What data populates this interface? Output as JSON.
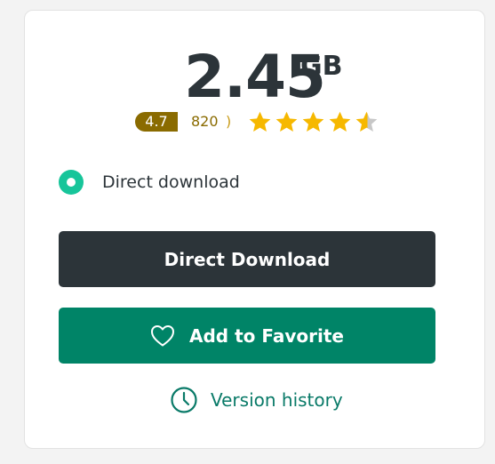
{
  "file": {
    "size_value": "2.45",
    "size_unit": "GB"
  },
  "rating": {
    "score": "4.7",
    "count": "820",
    "count_suffix": ")",
    "stars_value": 4.7,
    "stars_max": 5
  },
  "options": {
    "direct_download_label": "Direct download",
    "selected": true
  },
  "buttons": {
    "direct_download": "Direct Download",
    "add_favorite": "Add to Favorite",
    "version_history": "Version history"
  },
  "colors": {
    "dark": "#2c3439",
    "green": "#008467",
    "teal": "#17c59a",
    "star": "#f6b800",
    "badge": "#8a6b00",
    "link": "#097a68"
  },
  "icons": {
    "radio": "radio-selected-icon",
    "favorite": "heart-icon",
    "history": "clock-icon",
    "star": "star-icon"
  }
}
